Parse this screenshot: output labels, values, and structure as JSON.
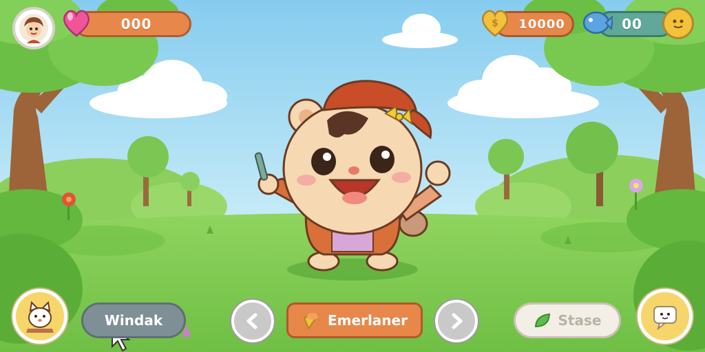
{
  "hud": {
    "hearts_value": "000",
    "coins_value": "10000",
    "fish_value": "00"
  },
  "bottom_bar": {
    "left_button_label": "Windak",
    "center_button_label": "Emerlaner",
    "right_button_label": "Stase"
  },
  "icons": {
    "avatar": "avatar-icon",
    "heart": "heart-icon",
    "coin": "coin-icon",
    "fish": "fish-icon",
    "smiley": "smiley-icon",
    "pet": "cat-icon",
    "prev": "chevron-left-icon",
    "next": "chevron-right-icon",
    "cone": "ice-cream-icon",
    "leaf": "leaf-icon",
    "chat": "chat-icon",
    "cursor": "cursor-icon"
  },
  "colors": {
    "sky": "#9fd8f3",
    "grass": "#7ccb52",
    "orange": "#e8874a",
    "gold": "#f3c13a",
    "teal": "#5fa89a",
    "blue": "#5aa4e0"
  }
}
